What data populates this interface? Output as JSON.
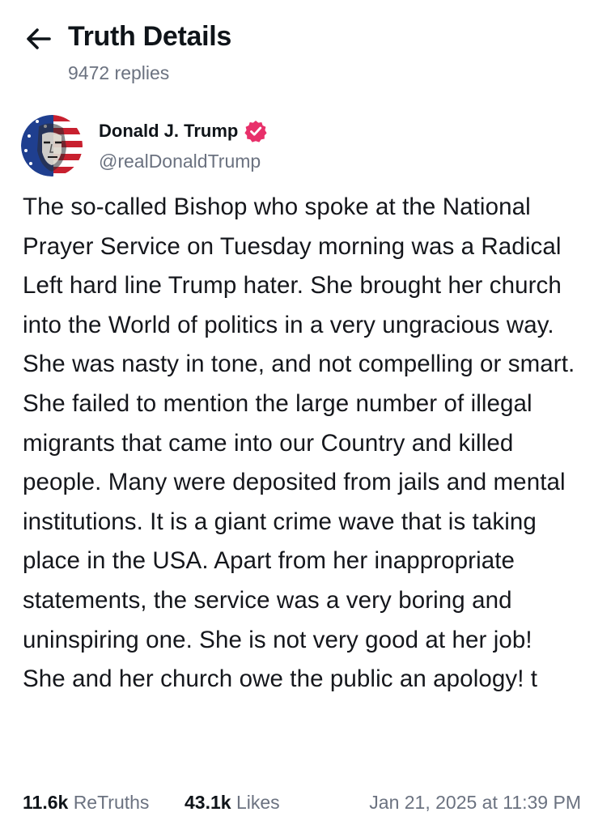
{
  "header": {
    "title": "Truth Details",
    "replies": "9472 replies"
  },
  "author": {
    "name": "Donald J. Trump",
    "handle": "@realDonaldTrump"
  },
  "post": {
    "text": "The so-called Bishop who spoke at the National Prayer Service on Tuesday morning was a Radical Left hard line Trump hater. She brought her church into the World of politics in a very ungracious way. She was nasty in tone, and not compelling or smart. She failed to mention the large number of illegal migrants that came into our Country and killed people. Many were deposited from jails and mental institutions. It is a giant crime wave that is taking place in the USA. Apart from her inappropriate statements, the service was a very boring and uninspiring one. She is not very good at her job! She and her church owe the public an apology! t"
  },
  "stats": {
    "retruths_count": "11.6k",
    "retruths_label": "ReTruths",
    "likes_count": "43.1k",
    "likes_label": "Likes",
    "timestamp": "Jan 21, 2025 at 11:39 PM"
  },
  "colors": {
    "verified_badge": "#e8306a",
    "muted_text": "#6b7280",
    "primary_text": "#0f1419"
  }
}
